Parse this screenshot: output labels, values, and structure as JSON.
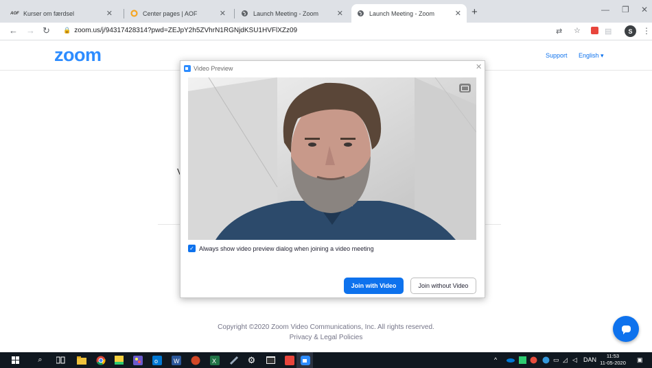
{
  "browser": {
    "tabs": [
      {
        "title": "Kurser om færdsel",
        "favicon": "aof-icon"
      },
      {
        "title": "Center pages | AOF",
        "favicon": "circle-orange-icon"
      },
      {
        "title": "Launch Meeting - Zoom",
        "favicon": "globe-icon"
      },
      {
        "title": "Launch Meeting - Zoom",
        "favicon": "globe-icon",
        "active": true
      }
    ],
    "url": "zoom.us/j/94317428314?pwd=ZEJpY2h5ZVhrN1RGNjdKSU1HVFlXZz09",
    "profile_initial": "S"
  },
  "page": {
    "logo": "zoom",
    "nav": {
      "support": "Support",
      "language": "English ▾"
    },
    "partial_text": "V",
    "copyright": "Copyright ©2020 Zoom Video Communications, Inc. All rights reserved.",
    "privacy": "Privacy & Legal Policies"
  },
  "dialog": {
    "title": "Video Preview",
    "always_show_label": "Always show video preview dialog when joining a video meeting",
    "always_show_checked": true,
    "join_with_video": "Join with Video",
    "join_without_video": "Join without Video"
  },
  "taskbar": {
    "language": "DAN",
    "time": "11:53",
    "date": "11-05-2020"
  },
  "colors": {
    "zoom_blue": "#2d8cff",
    "button_blue": "#0e72ed",
    "taskbar": "#101820"
  }
}
